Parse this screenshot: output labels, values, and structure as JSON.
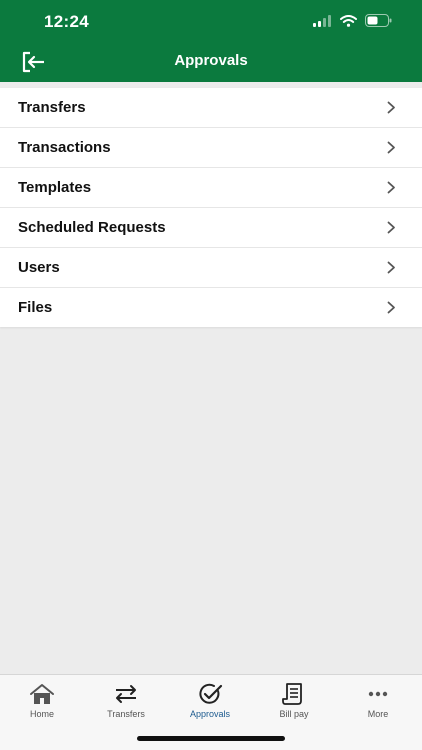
{
  "status_bar": {
    "time": "12:24",
    "icons": [
      "signal-icon",
      "wifi-icon",
      "battery-icon"
    ]
  },
  "nav": {
    "title": "Approvals",
    "left_icon": "logout-icon"
  },
  "colors": {
    "header": "#0b7a3e",
    "active_tab": "#1c5a8e",
    "background": "#ececec"
  },
  "menu": {
    "items": [
      {
        "label": "Transfers"
      },
      {
        "label": "Transactions"
      },
      {
        "label": "Templates"
      },
      {
        "label": "Scheduled Requests"
      },
      {
        "label": "Users"
      },
      {
        "label": "Files"
      }
    ]
  },
  "tabs": {
    "active": "Approvals",
    "items": [
      {
        "label": "Home",
        "icon": "home-icon"
      },
      {
        "label": "Transfers",
        "icon": "transfer-arrows-icon"
      },
      {
        "label": "Approvals",
        "icon": "check-circle-icon"
      },
      {
        "label": "Bill pay",
        "icon": "receipt-icon"
      },
      {
        "label": "More",
        "icon": "more-dots-icon"
      }
    ]
  }
}
